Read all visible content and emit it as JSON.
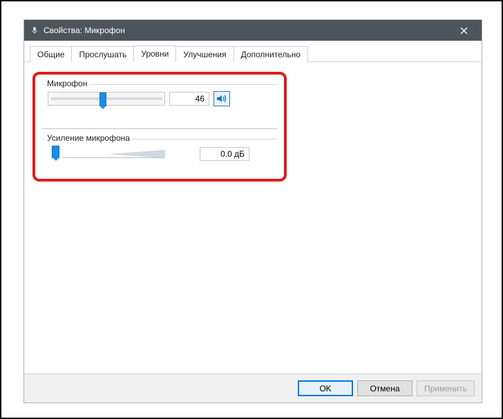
{
  "window": {
    "title": "Свойства: Микрофон"
  },
  "tabs": {
    "t0": "Общие",
    "t1": "Прослушать",
    "t2": "Уровни",
    "t3": "Улучшения",
    "t4": "Дополнительно"
  },
  "levels": {
    "mic": {
      "label": "Микрофон",
      "value": "46",
      "percent": 46
    },
    "boost": {
      "label": "Усиление микрофона",
      "value": "0.0 дБ",
      "percent": 0
    }
  },
  "buttons": {
    "ok": "OK",
    "cancel": "Отмена",
    "apply": "Применить"
  }
}
